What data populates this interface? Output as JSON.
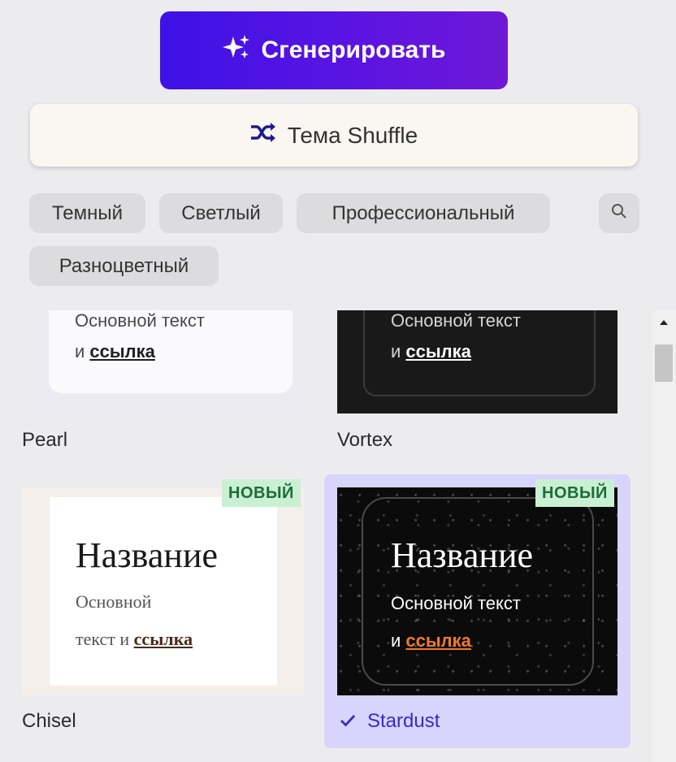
{
  "buttons": {
    "generate": {
      "label": "Сгенерировать",
      "icon": "sparkles-icon"
    },
    "shuffle": {
      "label": "Тема Shuffle",
      "icon": "shuffle-icon"
    }
  },
  "filters": {
    "chips": [
      "Темный",
      "Светлый",
      "Профессиональный",
      "Разноцветный"
    ],
    "search_icon": "search-icon"
  },
  "themes": [
    {
      "name": "Pearl",
      "preview": {
        "body": "Основной текст",
        "prefix": "и",
        "link": "ссылка"
      }
    },
    {
      "name": "Vortex",
      "preview": {
        "body": "Основной текст",
        "prefix": "и",
        "link": "ссылка"
      }
    },
    {
      "name": "Chisel",
      "badge": "НОВЫЙ",
      "preview": {
        "title": "Название",
        "body1": "Основной",
        "body2": "текст и",
        "link": "ссылка"
      }
    },
    {
      "name": "Stardust",
      "badge": "НОВЫЙ",
      "selected": true,
      "preview": {
        "title": "Название",
        "body": "Основной текст",
        "prefix": "и",
        "link": "ссылка"
      }
    }
  ],
  "colors": {
    "accent_start": "#3d12e6",
    "accent_end": "#6f18d6",
    "selected_bg": "#d8d4fb",
    "selected_text": "#3b2ac6",
    "badge_bg": "#c9f0d3",
    "stardust_link": "#f07a2b"
  }
}
